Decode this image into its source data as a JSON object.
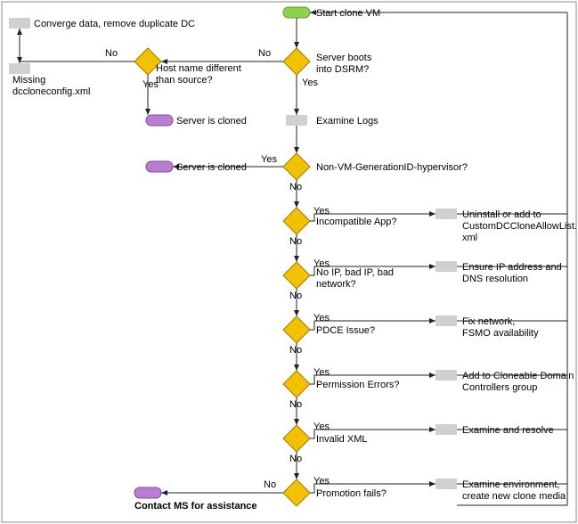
{
  "chart_data": {
    "type": "flowchart",
    "title": "",
    "nodes": [
      {
        "id": "start",
        "type": "terminator",
        "label": "Start clone VM"
      },
      {
        "id": "dsrm",
        "type": "decision",
        "label": "Server boots into DSRM?"
      },
      {
        "id": "host",
        "type": "decision",
        "label": "Host name different than source?"
      },
      {
        "id": "converge",
        "type": "process",
        "label": "Converge data, remove duplicate DC"
      },
      {
        "id": "missing",
        "type": "process",
        "label": "Missing dccloneconfig.xml"
      },
      {
        "id": "cloned1",
        "type": "terminator",
        "label": "Server is cloned"
      },
      {
        "id": "cloned2",
        "type": "terminator",
        "label": "Server is cloned"
      },
      {
        "id": "examine",
        "type": "process",
        "label": "Examine Logs"
      },
      {
        "id": "nonvm",
        "type": "decision",
        "label": "Non-VM-GenerationID-hypervisor?"
      },
      {
        "id": "incompat",
        "type": "decision",
        "label": "Incompatible App?"
      },
      {
        "id": "incompat_fix",
        "type": "process",
        "label": "Uninstall or add to CustomDCCloneAllowList.xml"
      },
      {
        "id": "noip",
        "type": "decision",
        "label": "No IP, bad IP, bad network?"
      },
      {
        "id": "noip_fix",
        "type": "process",
        "label": "Ensure IP address and DNS resolution"
      },
      {
        "id": "pdce",
        "type": "decision",
        "label": "PDCE Issue?"
      },
      {
        "id": "pdce_fix",
        "type": "process",
        "label": "Fix network, FSMO availability"
      },
      {
        "id": "perm",
        "type": "decision",
        "label": "Permission Errors?"
      },
      {
        "id": "perm_fix",
        "type": "process",
        "label": "Add to Cloneable Domain Controllers group"
      },
      {
        "id": "xml",
        "type": "decision",
        "label": "Invalid XML"
      },
      {
        "id": "xml_fix",
        "type": "process",
        "label": "Examine and resolve"
      },
      {
        "id": "promo",
        "type": "decision",
        "label": "Promotion fails?"
      },
      {
        "id": "promo_fix",
        "type": "process",
        "label": "Examine environment, create new clone media"
      },
      {
        "id": "contact",
        "type": "terminator",
        "label": "Contact MS for assistance"
      }
    ],
    "edges": [
      {
        "from": "start",
        "to": "dsrm"
      },
      {
        "from": "dsrm",
        "to": "host",
        "label": "No"
      },
      {
        "from": "dsrm",
        "to": "examine",
        "label": "Yes"
      },
      {
        "from": "host",
        "to": "converge",
        "label": "No"
      },
      {
        "from": "host",
        "to": "cloned1",
        "label": "Yes"
      },
      {
        "from": "converge",
        "to": "missing"
      },
      {
        "from": "examine",
        "to": "nonvm"
      },
      {
        "from": "nonvm",
        "to": "cloned2",
        "label": "Yes"
      },
      {
        "from": "nonvm",
        "to": "incompat",
        "label": "No"
      },
      {
        "from": "incompat",
        "to": "incompat_fix",
        "label": "Yes"
      },
      {
        "from": "incompat",
        "to": "noip",
        "label": "No"
      },
      {
        "from": "incompat_fix",
        "to": "start"
      },
      {
        "from": "noip",
        "to": "noip_fix",
        "label": "Yes"
      },
      {
        "from": "noip",
        "to": "pdce",
        "label": "No"
      },
      {
        "from": "noip_fix",
        "to": "start"
      },
      {
        "from": "pdce",
        "to": "pdce_fix",
        "label": "Yes"
      },
      {
        "from": "pdce",
        "to": "perm",
        "label": "No"
      },
      {
        "from": "pdce_fix",
        "to": "start"
      },
      {
        "from": "perm",
        "to": "perm_fix",
        "label": "Yes"
      },
      {
        "from": "perm",
        "to": "xml",
        "label": "No"
      },
      {
        "from": "perm_fix",
        "to": "start"
      },
      {
        "from": "xml",
        "to": "xml_fix",
        "label": "Yes"
      },
      {
        "from": "xml",
        "to": "promo",
        "label": "No"
      },
      {
        "from": "xml_fix",
        "to": "start"
      },
      {
        "from": "promo",
        "to": "promo_fix",
        "label": "Yes"
      },
      {
        "from": "promo",
        "to": "contact",
        "label": "No"
      },
      {
        "from": "promo_fix",
        "to": "start"
      }
    ]
  },
  "labels": {
    "start": "Start clone VM",
    "dsrm": "Server boots",
    "dsrm2": "into DSRM?",
    "host": "Host name different",
    "host2": "than source?",
    "converge": "Converge data, remove duplicate DC",
    "missing1": "Missing",
    "missing2": "dccloneconfig.xml",
    "cloned": "Server is cloned",
    "examine": "Examine Logs",
    "nonvm": "Non-VM-GenerationID-hypervisor?",
    "incompat": "Incompatible App?",
    "incompat_fix1": "Uninstall or add to",
    "incompat_fix2": "CustomDCCloneAllowList.",
    "incompat_fix3": "xml",
    "noip": "No IP, bad IP, bad",
    "noip2": "network?",
    "noip_fix1": "Ensure IP address and",
    "noip_fix2": "DNS resolution",
    "pdce": "PDCE Issue?",
    "pdce_fix1": "Fix network,",
    "pdce_fix2": "FSMO availability",
    "perm": "Permission Errors?",
    "perm_fix1": "Add to Cloneable Domain",
    "perm_fix2": "Controllers group",
    "xml": "Invalid XML",
    "xml_fix": "Examine and resolve",
    "promo": "Promotion fails?",
    "promo_fix1": "Examine environment,",
    "promo_fix2": "create new clone media",
    "contact": "Contact MS for assistance",
    "yes": "Yes",
    "no": "No"
  }
}
